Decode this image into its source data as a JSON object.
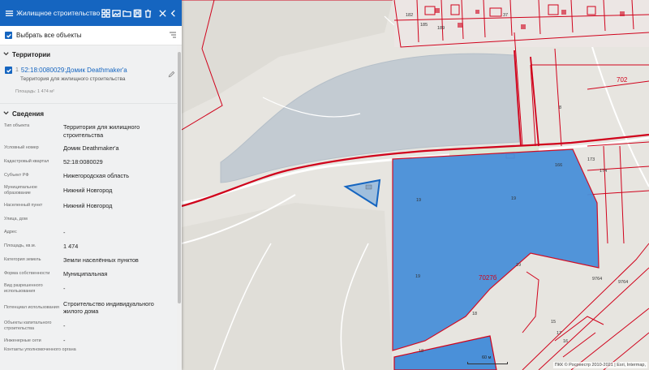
{
  "header": {
    "title": "Жилищное строительство",
    "icons": [
      "grid-icon",
      "image-icon",
      "folder-icon",
      "save-icon",
      "trash-icon",
      "close-icon"
    ]
  },
  "select_all": {
    "label": "Выбрать все объекты",
    "checked": true
  },
  "territories": {
    "heading": "Территории",
    "object": {
      "number": "1",
      "name": "52:18:0080029:Домик Deathmaker'а",
      "subtitle": "Территория для жилищного строительства",
      "area": "Площадь: 1 474 м²",
      "checked": true
    }
  },
  "details": {
    "heading": "Сведения",
    "rows": [
      {
        "key": "Тип объекта",
        "value": "Территория для жилищного строительства"
      },
      {
        "key": "Условный номер",
        "value": "Домик Deathmaker'а"
      },
      {
        "key": "Кадастровый квартал",
        "value": "52:18:0080029"
      },
      {
        "key": "Субъект РФ",
        "value": "Нижегородская область"
      },
      {
        "key": "Муниципальное образование",
        "value": "Нижний Новгород"
      },
      {
        "key": "Населенный пункт",
        "value": "Нижний Новгород"
      },
      {
        "key": "Улица, дом",
        "value": ""
      },
      {
        "key": "Адрес",
        "value": "-"
      },
      {
        "key": "Площадь, кв.м.",
        "value": "1 474"
      },
      {
        "key": "Категория земель",
        "value": "Земли населённых пунктов"
      },
      {
        "key": "Форма собственности",
        "value": "Муниципальная"
      },
      {
        "key": "Вид разрешенного использования",
        "value": "-"
      },
      {
        "key": "Потенциал использования",
        "value": "Строительство индивидуального жилого дома"
      },
      {
        "key": "Объекты капитального строительства",
        "value": "-"
      },
      {
        "key": "Инженерные сети",
        "value": "-"
      },
      {
        "key": "Контакты уполномоченного органа",
        "value": ""
      }
    ]
  },
  "map": {
    "labels": {
      "block": "7027б",
      "block_top": "702",
      "parcel_19a": "19",
      "parcel_19b": "19",
      "parcel_19c": "19",
      "parcel_19d": "19",
      "parcel_18a": "18",
      "parcel_18b": "18",
      "parcel_8": "8",
      "num_182": "182",
      "num_185": "185",
      "num_189": "189",
      "num_37": "37",
      "num_166": "166",
      "num_173": "173",
      "num_174": "174",
      "num_9764a": "9764",
      "num_9764b": "9764",
      "num_15": "15",
      "num_17": "17",
      "num_16": "16"
    },
    "scale_label": "60 м",
    "attribution": "ПКК © Росреестр 2010-2021 | Esri, Intermap,",
    "colors": {
      "water": "#c3cbd2",
      "selected_fill": "#4a90d9",
      "boundary": "#d0021b",
      "highlight": "#1565c0"
    }
  }
}
